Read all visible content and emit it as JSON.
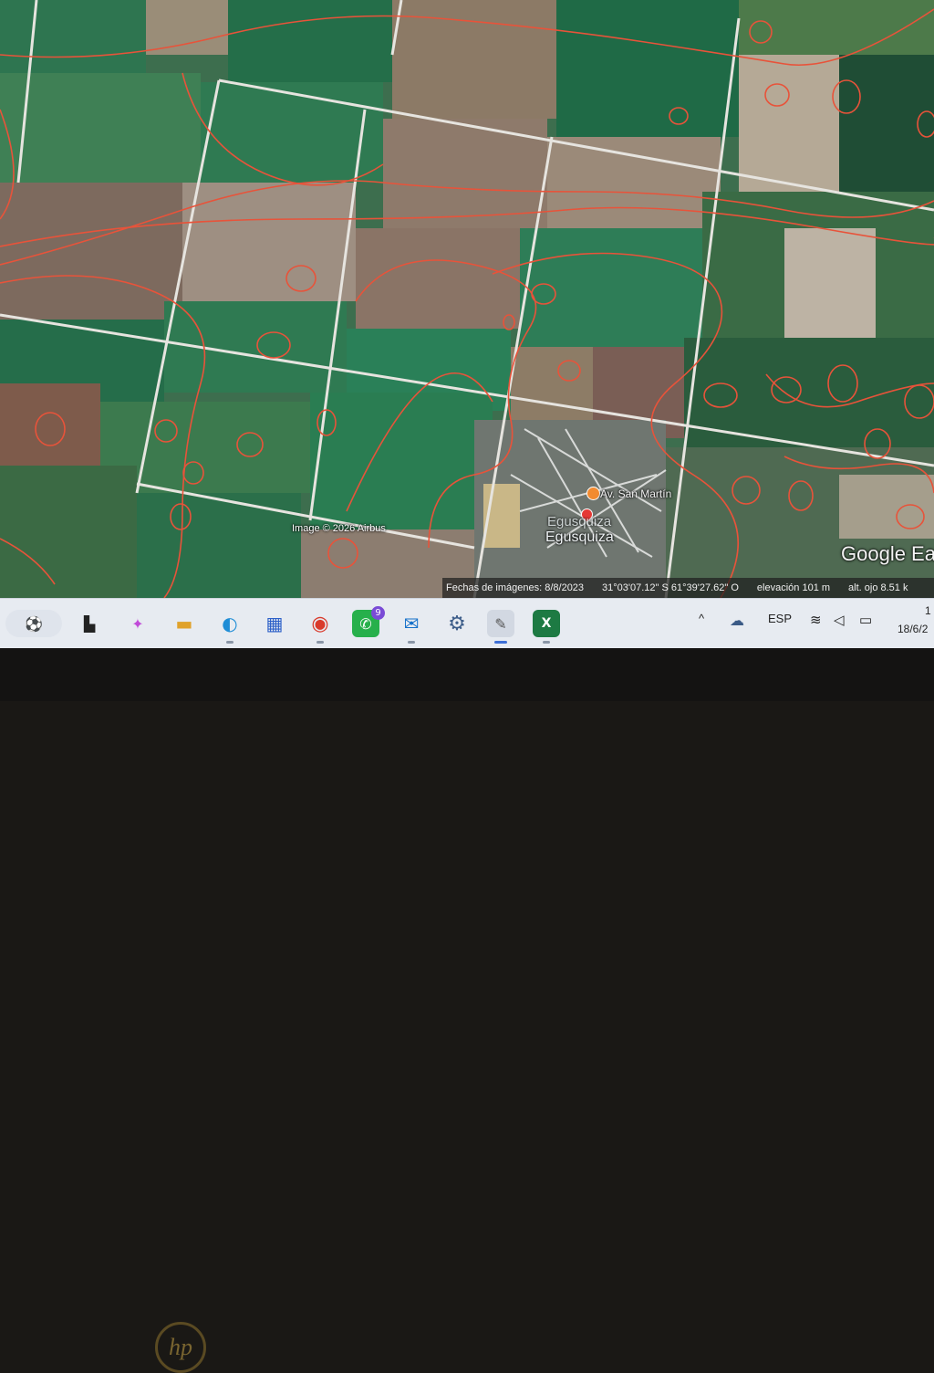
{
  "map": {
    "place_name": "Egusquiza",
    "place_name_secondary": "Egusquiza",
    "street_label": "Av. San Martín",
    "imagery_credit": "Image © 2026 Airbus",
    "brand": "Google Ea",
    "status": {
      "imagery_date": "Fechas de imágenes: 8/8/2023",
      "coordinates": "31°03'07.12\" S  61°39'27.62\" O",
      "elevation": "elevación   101 m",
      "eye_altitude": "alt. ojo   8.51 k"
    },
    "colors": {
      "contour": "#e8533a",
      "field_green": "#2f7a52",
      "field_brown": "#8a7460",
      "road": "#e6e4df"
    }
  },
  "taskbar": {
    "apps": [
      {
        "name": "soccer-app-icon",
        "glyph": "⚽"
      },
      {
        "name": "task-view-icon",
        "glyph": "▙"
      },
      {
        "name": "copilot-icon",
        "glyph": "✦"
      },
      {
        "name": "file-explorer-icon",
        "glyph": "▬"
      },
      {
        "name": "edge-icon",
        "glyph": "◐"
      },
      {
        "name": "microsoft-store-icon",
        "glyph": "▦"
      },
      {
        "name": "chrome-icon",
        "glyph": "◉"
      },
      {
        "name": "whatsapp-icon",
        "glyph": "✆"
      },
      {
        "name": "outlook-icon",
        "glyph": "✉"
      },
      {
        "name": "settings-icon",
        "glyph": "⚙"
      },
      {
        "name": "pen-app-icon",
        "glyph": "✎"
      },
      {
        "name": "excel-icon",
        "glyph": "X"
      }
    ],
    "whatsapp_badge": "9",
    "tray": {
      "chevron": "^",
      "language": "ESP",
      "time": "1",
      "date": "18/6/2"
    }
  },
  "device": {
    "logo": "hp"
  }
}
